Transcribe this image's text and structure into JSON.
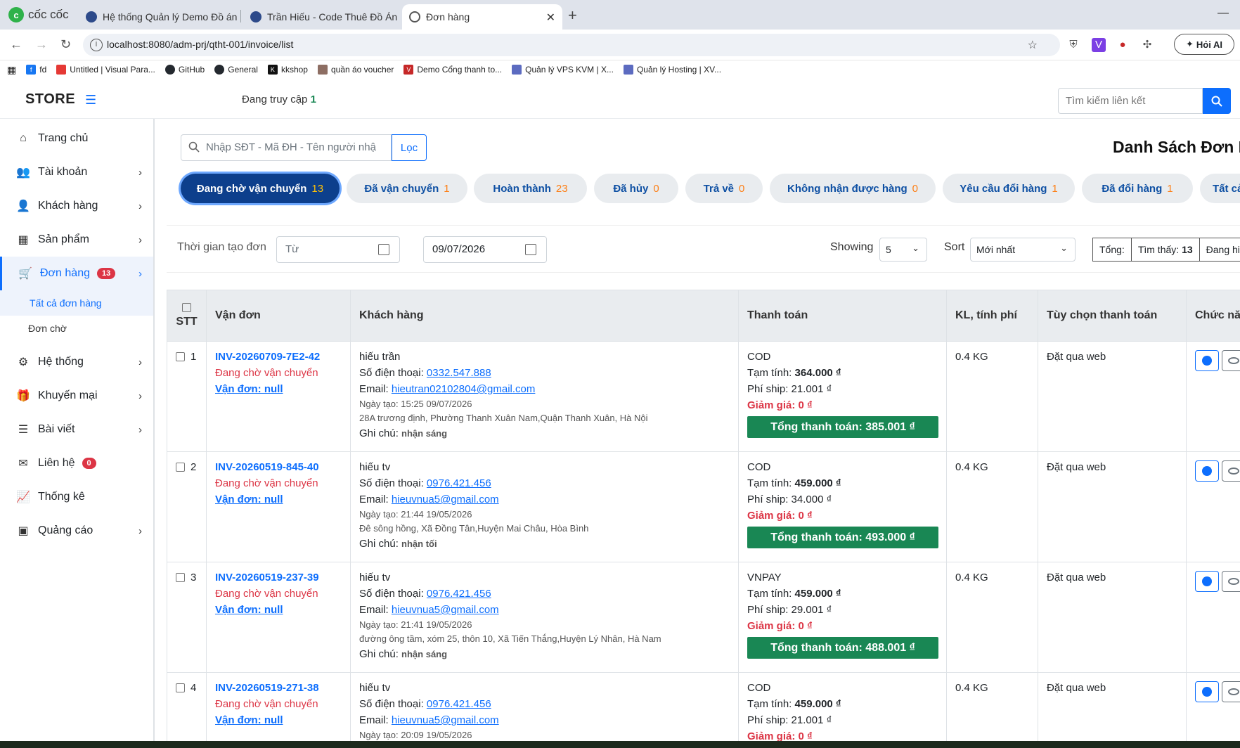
{
  "browser": {
    "brand": "cốc cốc",
    "tabs": [
      {
        "title": "Hệ thống Quản lý Demo Đồ án"
      },
      {
        "title": "Trần Hiếu - Code Thuê Đồ Án - J"
      },
      {
        "title": "Đơn hàng"
      }
    ],
    "url": "localhost:8080/adm-prj/qtht-001/invoice/list",
    "hoi_ai": "Hỏi AI",
    "bookmarks": [
      {
        "label": "fd"
      },
      {
        "label": "Untitled | Visual Para..."
      },
      {
        "label": "GitHub"
      },
      {
        "label": "General"
      },
      {
        "label": "kkshop"
      },
      {
        "label": "quần áo voucher"
      },
      {
        "label": "Demo Cổng thanh to..."
      },
      {
        "label": "Quản lý VPS KVM | X..."
      },
      {
        "label": "Quản lý Hosting | XV..."
      }
    ]
  },
  "header": {
    "logo": "STORE",
    "online_label": "Đang truy cập",
    "online_count": "1",
    "search_placeholder": "Tìm kiếm liên kết"
  },
  "sidebar": {
    "items": [
      {
        "label": "Trang chủ"
      },
      {
        "label": "Tài khoản"
      },
      {
        "label": "Khách hàng"
      },
      {
        "label": "Sản phẩm"
      },
      {
        "label": "Đơn hàng",
        "badge": "13"
      },
      {
        "label": "Hệ thống"
      },
      {
        "label": "Khuyến mại"
      },
      {
        "label": "Bài viết"
      },
      {
        "label": "Liên hệ",
        "badge": "0"
      },
      {
        "label": "Thống kê"
      },
      {
        "label": "Quảng cáo"
      }
    ],
    "sub_items": [
      {
        "label": "Tất cả đơn hàng"
      },
      {
        "label": "Đơn chờ"
      }
    ]
  },
  "main": {
    "search_placeholder": "Nhập SĐT - Mã ĐH - Tên người nhậ",
    "filter_button": "Lọc",
    "title": "Danh Sách Đơn H",
    "status_tabs": [
      {
        "label": "Đang chờ vận chuyển",
        "count": "13"
      },
      {
        "label": "Đã vận chuyển",
        "count": "1"
      },
      {
        "label": "Hoàn thành",
        "count": "23"
      },
      {
        "label": "Đã hủy",
        "count": "0"
      },
      {
        "label": "Trả về",
        "count": "0"
      },
      {
        "label": "Không nhận được hàng",
        "count": "0"
      },
      {
        "label": "Yêu cầu đổi hàng",
        "count": "1"
      },
      {
        "label": "Đã đổi hàng",
        "count": "1"
      },
      {
        "label": "Tất cả",
        "count": ""
      }
    ],
    "toolbar": {
      "date_label": "Thời gian tạo đơn",
      "date_from_placeholder": "Từ",
      "date_to": "09/07/2026",
      "showing_label": "Showing",
      "showing_value": "5",
      "sort_label": "Sort",
      "sort_value": "Mới nhất",
      "total_label": "Tổng:",
      "found_label": "Tìm thấy:",
      "found_value": "13",
      "showing_more": "Đang hi"
    },
    "table": {
      "headers": {
        "stt": "STT",
        "van_don": "Vận đơn",
        "khach_hang": "Khách hàng",
        "thanh_toan": "Thanh toán",
        "kl": "KL, tính phí",
        "tuy_chon": "Tùy chọn thanh toán",
        "chuc_nang": "Chức nă"
      },
      "rows": [
        {
          "stt": "1",
          "inv": "INV-20260709-7E2-42",
          "status": "Đang chờ vận chuyển",
          "van_don": "Vận đơn: null",
          "name": "hiếu trần",
          "phone_label": "Số điện thoại:",
          "phone": "0332.547.888",
          "email_label": "Email:",
          "email": "hieutran02102804@gmail.com",
          "created": "Ngày tạo: 15:25 09/07/2026",
          "address": "28A trương định, Phường Thanh Xuân Nam,Quận Thanh Xuân, Hà Nội",
          "note_label": "Ghi chú:",
          "note": "nhận sáng",
          "method": "COD",
          "subtotal_label": "Tạm tính:",
          "subtotal": "364.000 ₫",
          "ship": "Phí ship: 21.001 ₫",
          "discount": "Giảm giá: 0 ₫",
          "total": "Tổng thanh toán: 385.001 ₫",
          "weight": "0.4 KG",
          "option": "Đặt qua web"
        },
        {
          "stt": "2",
          "inv": "INV-20260519-845-40",
          "status": "Đang chờ vận chuyển",
          "van_don": "Vận đơn: null",
          "name": "hiếu tv",
          "phone_label": "Số điện thoại:",
          "phone": "0976.421.456",
          "email_label": "Email:",
          "email": "hieuvnua5@gmail.com",
          "created": "Ngày tạo: 21:44 19/05/2026",
          "address": "Đê sông hồng, Xã Đồng Tân,Huyện Mai Châu, Hòa Bình",
          "note_label": "Ghi chú:",
          "note": "nhận tối",
          "method": "COD",
          "subtotal_label": "Tạm tính:",
          "subtotal": "459.000 ₫",
          "ship": "Phí ship: 34.000 ₫",
          "discount": "Giảm giá: 0 ₫",
          "total": "Tổng thanh toán: 493.000 ₫",
          "weight": "0.4 KG",
          "option": "Đặt qua web"
        },
        {
          "stt": "3",
          "inv": "INV-20260519-237-39",
          "status": "Đang chờ vận chuyển",
          "van_don": "Vận đơn: null",
          "name": "hiếu tv",
          "phone_label": "Số điện thoại:",
          "phone": "0976.421.456",
          "email_label": "Email:",
          "email": "hieuvnua5@gmail.com",
          "created": "Ngày tạo: 21:41 19/05/2026",
          "address": "đường ông tầm, xóm 25, thôn 10, Xã Tiến Thắng,Huyện Lý Nhân, Hà Nam",
          "note_label": "Ghi chú:",
          "note": "nhận sáng",
          "method": "VNPAY",
          "subtotal_label": "Tạm tính:",
          "subtotal": "459.000 ₫",
          "ship": "Phí ship: 29.001 ₫",
          "discount": "Giảm giá: 0 ₫",
          "total": "Tổng thanh toán: 488.001 ₫",
          "weight": "0.4 KG",
          "option": "Đặt qua web"
        },
        {
          "stt": "4",
          "inv": "INV-20260519-271-38",
          "status": "Đang chờ vận chuyển",
          "van_don": "Vận đơn: null",
          "name": "hiếu tv",
          "phone_label": "Số điện thoại:",
          "phone": "0976.421.456",
          "email_label": "Email:",
          "email": "hieuvnua5@gmail.com",
          "created": "Ngày tạo: 20:09 19/05/2026",
          "address": "",
          "note_label": "",
          "note": "",
          "method": "COD",
          "subtotal_label": "Tạm tính:",
          "subtotal": "459.000 ₫",
          "ship": "Phí ship: 21.001 ₫",
          "discount": "Giảm giá: 0 ₫",
          "total": "",
          "weight": "0.4 KG",
          "option": "Đặt qua web"
        }
      ]
    }
  }
}
